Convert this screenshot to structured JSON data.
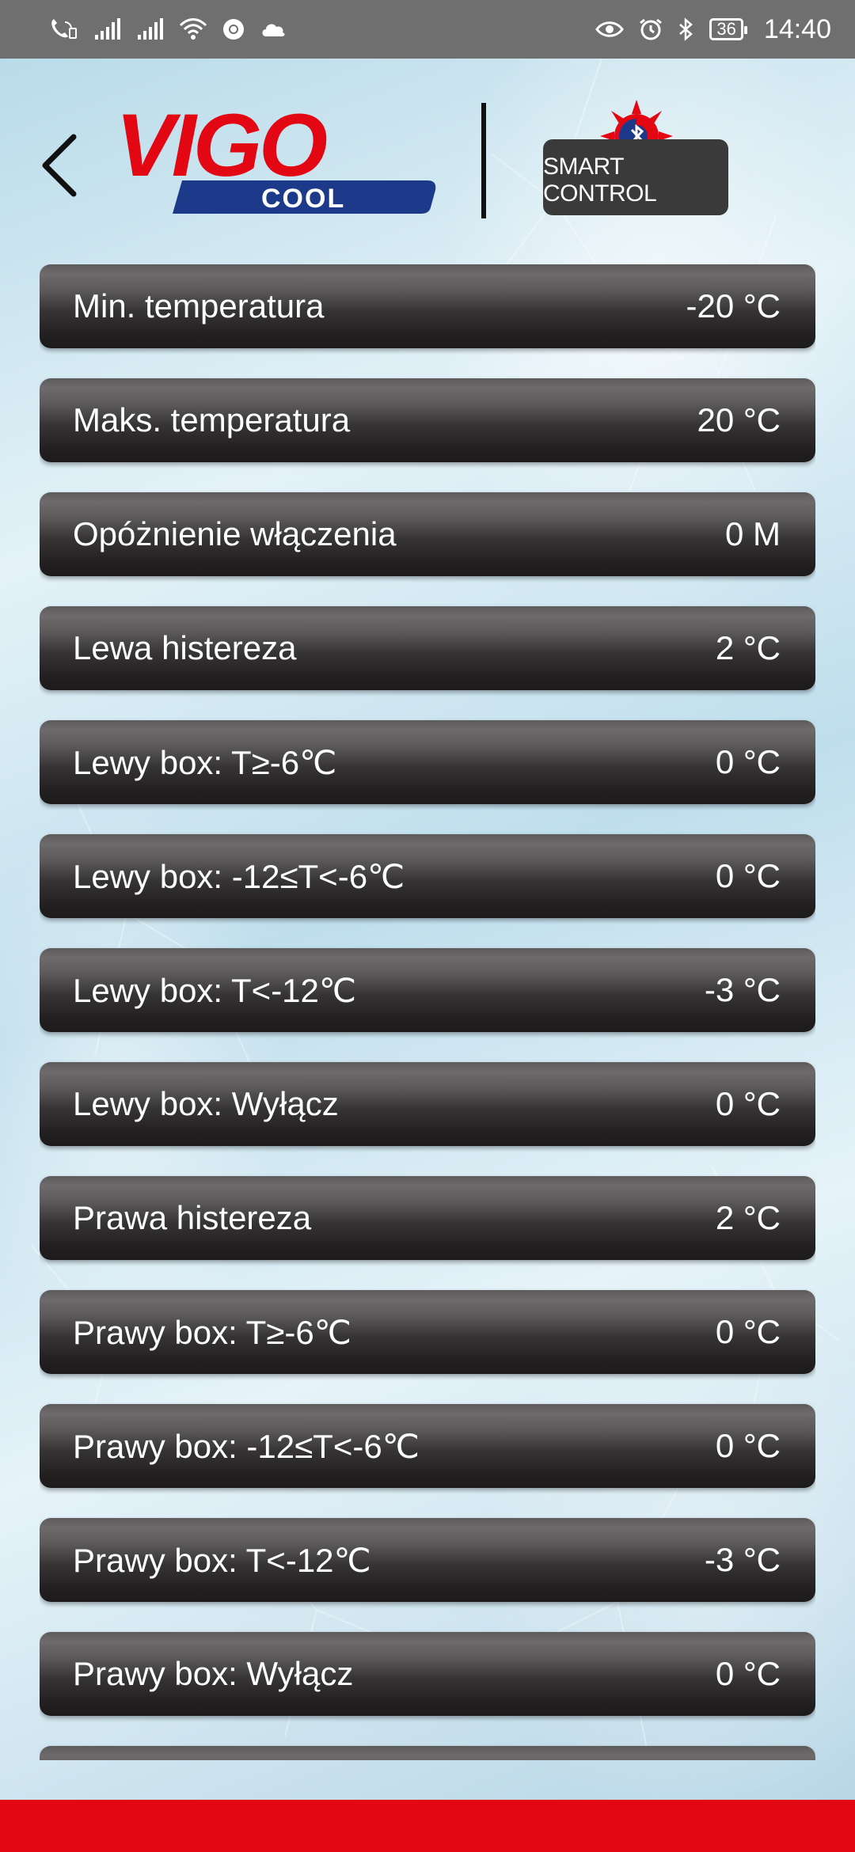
{
  "status_bar": {
    "time": "14:40",
    "battery": "36",
    "icons": [
      "wifi-calling-icon",
      "signal-icon",
      "signal-icon",
      "wifi-icon",
      "chrome-icon",
      "cloud-icon",
      "eye-icon",
      "alarm-icon",
      "bluetooth-icon",
      "battery-icon"
    ]
  },
  "header": {
    "back_icon": "chevron-left-icon",
    "brand_name": "VIGO",
    "brand_sub": "COOL",
    "smart_label": "SMART CONTROL",
    "colors": {
      "brand_red": "#e30613",
      "brand_blue": "#1d3a8a"
    }
  },
  "settings": [
    {
      "label": "Min. temperatura",
      "value": "-20 °C"
    },
    {
      "label": "Maks. temperatura",
      "value": "20 °C"
    },
    {
      "label": "Opóżnienie włączenia",
      "value": "0 M"
    },
    {
      "label": "Lewa histereza",
      "value": "2 °C"
    },
    {
      "label": "Lewy box: T≥-6℃",
      "value": "0 °C"
    },
    {
      "label": "Lewy box: -12≤T<-6℃",
      "value": "0 °C"
    },
    {
      "label": "Lewy box: T<-12℃",
      "value": "-3 °C"
    },
    {
      "label": "Lewy box: Wyłącz",
      "value": "0 °C"
    },
    {
      "label": "Prawa histereza",
      "value": "2 °C"
    },
    {
      "label": "Prawy box: T≥-6℃",
      "value": "0 °C"
    },
    {
      "label": "Prawy box: -12≤T<-6℃",
      "value": "0 °C"
    },
    {
      "label": "Prawy box: T<-12℃",
      "value": "-3 °C"
    },
    {
      "label": "Prawy box: Wyłącz",
      "value": "0 °C"
    },
    {
      "label": "",
      "value": ""
    }
  ],
  "footer": {
    "color": "#e30613"
  }
}
